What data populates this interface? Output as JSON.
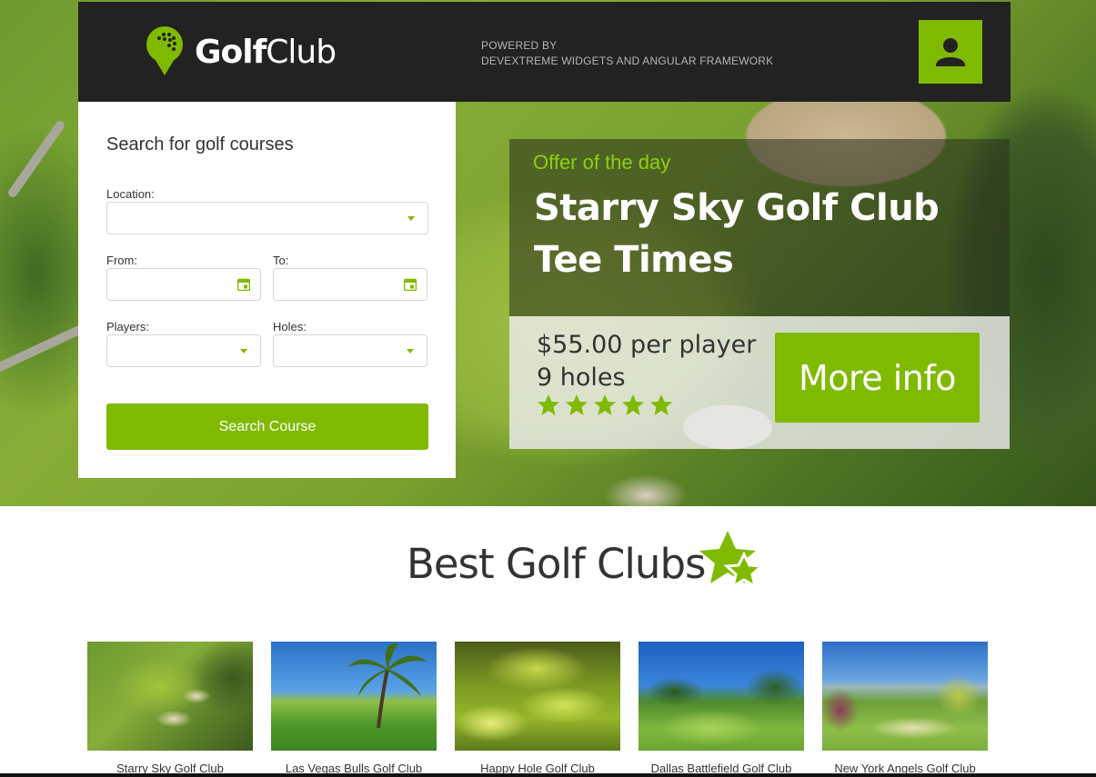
{
  "header": {
    "logo_bold": "Golf",
    "logo_regular": "Club",
    "powered_line1": "POWERED BY",
    "powered_line2": "DEVEXTREME WIDGETS AND ANGULAR FRAMEWORK",
    "user_icon": "user-icon"
  },
  "search": {
    "title": "Search for golf courses",
    "location_label": "Location:",
    "location_value": "",
    "from_label": "From:",
    "from_value": "",
    "to_label": "To:",
    "to_value": "",
    "players_label": "Players:",
    "players_value": "",
    "holes_label": "Holes:",
    "holes_value": "",
    "button_label": "Search Course"
  },
  "offer": {
    "label": "Offer of the day",
    "title": "Starry Sky Golf Club Tee Times",
    "price": "$55.00 per player",
    "holes": "9 holes",
    "rating": 5,
    "rating_max": 5,
    "button_label": "More info"
  },
  "best": {
    "title": "Best Golf Clubs",
    "clubs": [
      {
        "name": "Starry Sky Golf Club"
      },
      {
        "name": "Las Vegas Bulls Golf Club"
      },
      {
        "name": "Happy Hole Golf Club"
      },
      {
        "name": "Dallas Battlefield Golf Club"
      },
      {
        "name": "New York Angels Golf Club"
      }
    ]
  },
  "colors": {
    "accent": "#7fba00",
    "header_bg": "#222222"
  }
}
